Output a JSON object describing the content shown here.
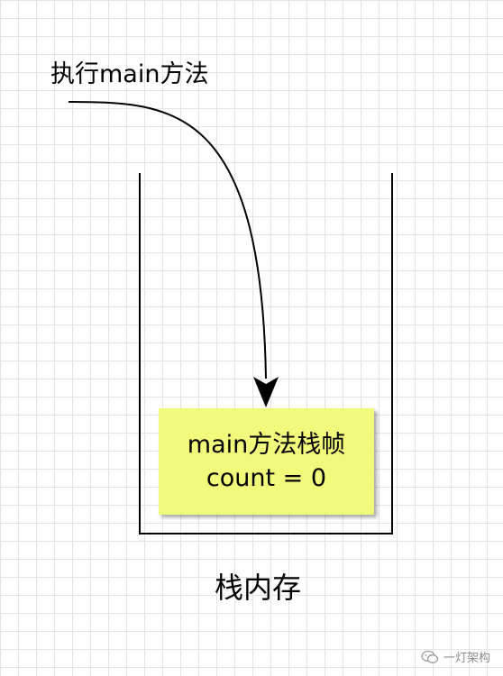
{
  "caption": "执行main方法",
  "stack_frame": {
    "title": "main方法栈帧",
    "variable": "count = 0"
  },
  "stack_label": "栈内存",
  "watermark": {
    "icon": "wechat-icon",
    "text": "一灯架构"
  },
  "colors": {
    "frame_fill": "#f1fa7a",
    "line": "#000000",
    "grid": "#e4e4e4"
  }
}
